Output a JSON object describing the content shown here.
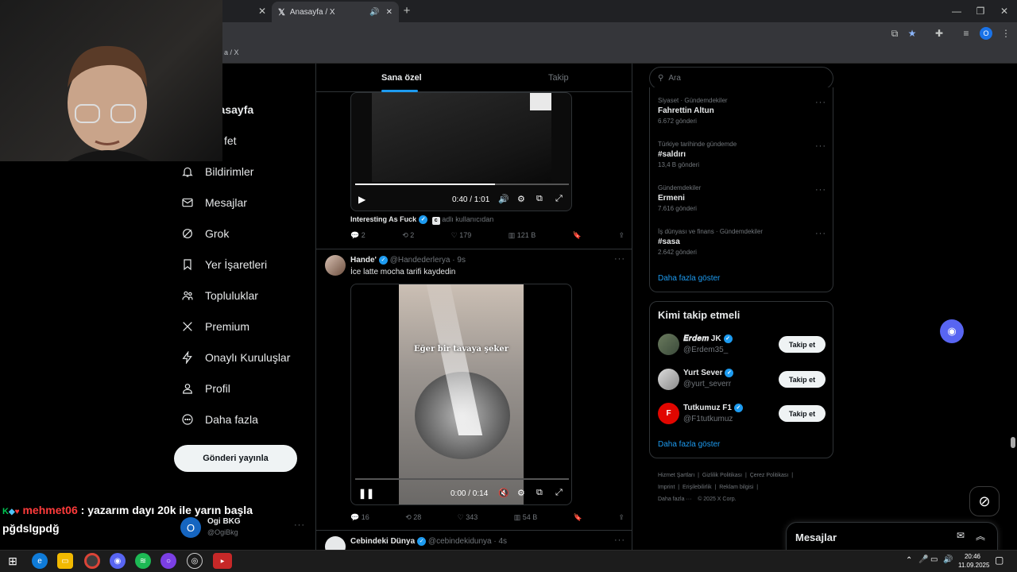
{
  "browser": {
    "tab_title": "Anasayfa / X",
    "breadcrumb_partial": "a / X",
    "profile_letter": "O"
  },
  "sidebar": {
    "items": [
      {
        "label": "Anasayfa",
        "shown": "nasayfa",
        "icon": "home-icon"
      },
      {
        "label": "Keşfet",
        "shown": "fet",
        "icon": "search-icon"
      },
      {
        "label": "Bildirimler",
        "icon": "bell-icon"
      },
      {
        "label": "Mesajlar",
        "icon": "mail-icon"
      },
      {
        "label": "Grok",
        "icon": "grok-icon"
      },
      {
        "label": "Yer İşaretleri",
        "icon": "bookmark-icon"
      },
      {
        "label": "Topluluklar",
        "icon": "communities-icon"
      },
      {
        "label": "Premium",
        "icon": "x-icon"
      },
      {
        "label": "Onaylı Kuruluşlar",
        "icon": "lightning-icon"
      },
      {
        "label": "Profil",
        "icon": "person-icon"
      },
      {
        "label": "Daha fazla",
        "icon": "more-circle-icon"
      }
    ],
    "post_button": "Gönderi yayınla",
    "account": {
      "name": "Ogi BKG",
      "handle": "@OgiBkg",
      "initial": "O"
    }
  },
  "feed": {
    "tabs": {
      "for_you": "Sana özel",
      "following": "Takip"
    },
    "post1": {
      "video_time": "0:40 / 1:01",
      "source_name": "Interesting As Fuck",
      "source_badge": "c",
      "source_suffix": "adlı kullanıcıdan",
      "replies": "2",
      "reposts": "2",
      "likes": "179",
      "views": "121 B"
    },
    "post2": {
      "name": "Hande'",
      "handle": "@Handederlerya",
      "time": "9s",
      "text": "İce latte mocha tarifi kaydedin",
      "video_caption": "Eğer bir tavaya şeker",
      "video_time": "0:00 / 0:14",
      "replies": "16",
      "reposts": "28",
      "likes": "343",
      "views": "54 B"
    },
    "post3": {
      "name": "Cebindeki Dünya",
      "handle": "@cebindekidunya",
      "time": "4s"
    }
  },
  "search": {
    "placeholder": "Ara"
  },
  "trends": [
    {
      "category": "Siyaset · Gündemdekiler",
      "name": "Fahrettin Altun",
      "count": "6.672 gönderi"
    },
    {
      "category": "Türkiye tarihinde gündemde",
      "name": "#saldırı",
      "count": "13,4 B gönderi"
    },
    {
      "category": "Gündemdekiler",
      "name": "Ermeni",
      "count": "7.616 gönderi"
    },
    {
      "category": "İş dünyası ve finans · Gündemdekiler",
      "name": "#sasa",
      "count": "2.642 gönderi"
    }
  ],
  "trends_more": "Daha fazla göster",
  "who_to_follow": {
    "title": "Kimi takip etmeli",
    "users": [
      {
        "name": "𝑬𝒓𝒅𝒆𝒎 JK",
        "handle": "@Erdem35_"
      },
      {
        "name": "Yurt Sever",
        "handle": "@yurt_severr"
      },
      {
        "name": "Tutkumuz F1",
        "handle": "@F1tutkumuz"
      }
    ],
    "follow_label": "Takip et",
    "more": "Daha fazla göster"
  },
  "footer": {
    "links": [
      "Hizmet Şartları",
      "Gizlilik Politikası",
      "Çerez Politikası",
      "Imprint",
      "Erişilebilirlik",
      "Reklam bilgisi",
      "Daha fazla ···",
      "© 2025 X Corp."
    ]
  },
  "messages_drawer": {
    "title": "Mesajlar"
  },
  "stream_chat": {
    "user": "mehmet06",
    "message": ": yazarım dayı 20k ile yarın başla pğdslgpdğ"
  },
  "taskbar": {
    "time": "20:46",
    "date": "11.09.2025"
  },
  "colors": {
    "accent": "#1d9bf0",
    "background": "#000000",
    "chat_user": "#ff3b3b"
  }
}
